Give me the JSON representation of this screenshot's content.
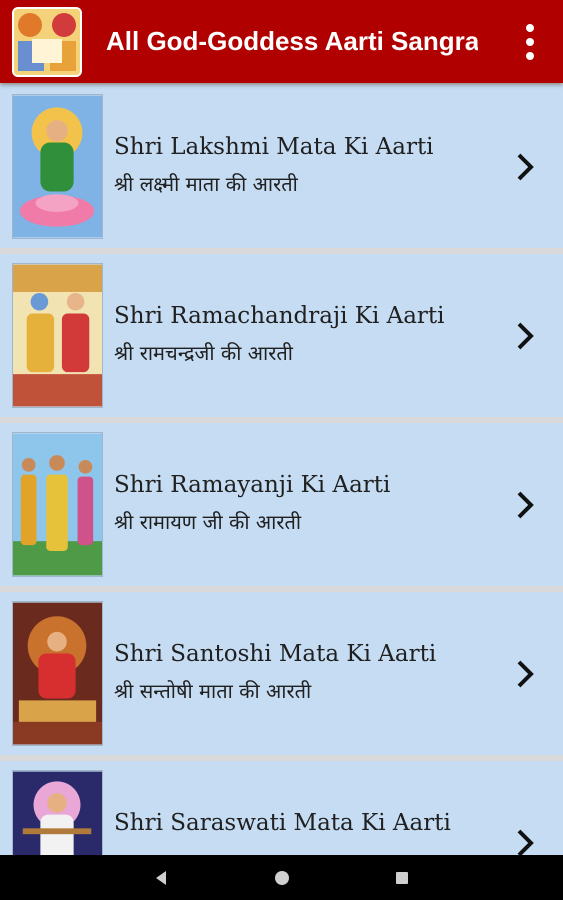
{
  "app": {
    "title": "All God-Goddess Aarti Sangrah",
    "icon": "app-logo-icon",
    "colors": {
      "appbar": "#b00000",
      "list_background": "#c5dcf3",
      "navbar": "#000000"
    }
  },
  "items": [
    {
      "title_en": "Shri Lakshmi Mata Ki Aarti",
      "title_hi": "श्री लक्ष्मी माता की आरती",
      "thumb_icon": "lakshmi-image-icon"
    },
    {
      "title_en": "Shri Ramachandraji Ki Aarti",
      "title_hi": "श्री रामचन्द्रजी की आरती",
      "thumb_icon": "ram-sita-image-icon"
    },
    {
      "title_en": "Shri Ramayanji Ki Aarti",
      "title_hi": "श्री रामायण जी की आरती",
      "thumb_icon": "ramayan-image-icon"
    },
    {
      "title_en": "Shri Santoshi Mata Ki Aarti",
      "title_hi": "श्री सन्तोषी माता की आरती",
      "thumb_icon": "santoshi-image-icon"
    },
    {
      "title_en": "Shri Saraswati Mata Ki Aarti",
      "title_hi": "",
      "thumb_icon": "saraswati-image-icon"
    }
  ],
  "navigation": {
    "back_icon": "back-triangle-icon",
    "home_icon": "home-circle-icon",
    "recents_icon": "recents-square-icon"
  }
}
